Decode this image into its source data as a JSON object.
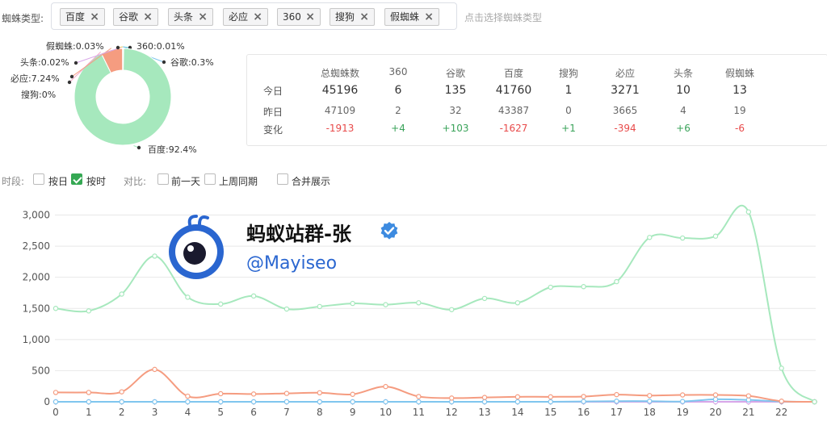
{
  "filter": {
    "label": "蜘蛛类型:",
    "tags": [
      {
        "label": "百度"
      },
      {
        "label": "谷歌"
      },
      {
        "label": "头条"
      },
      {
        "label": "必应"
      },
      {
        "label": "360"
      },
      {
        "label": "搜狗"
      },
      {
        "label": "假蜘蛛"
      }
    ],
    "placeholder": "点击选择蜘蛛类型"
  },
  "pie": {
    "slices": [
      {
        "name": "百度",
        "pct": 92.4,
        "label": "百度:92.4%",
        "color": "#a6e8bd"
      },
      {
        "name": "必应",
        "pct": 7.24,
        "label": "必应:7.24%",
        "color": "#f59c80"
      },
      {
        "name": "谷歌",
        "pct": 0.3,
        "label": "谷歌:0.3%",
        "color": "#7fc6ee"
      },
      {
        "name": "头条",
        "pct": 0.02,
        "label": "头条:0.02%",
        "color": "#d7a6e8"
      },
      {
        "name": "假蜘蛛",
        "pct": 0.03,
        "label": "假蜘蛛:0.03%",
        "color": "#f4d36b"
      },
      {
        "name": "360",
        "pct": 0.01,
        "label": "360:0.01%",
        "color": "#7ad3d3"
      },
      {
        "name": "搜狗",
        "pct": 0,
        "label": "搜狗:0%",
        "color": "#f5a9c8"
      }
    ]
  },
  "stats": {
    "headers": [
      "总蜘蛛数",
      "360",
      "谷歌",
      "百度",
      "搜狗",
      "必应",
      "头条",
      "假蜘蛛"
    ],
    "row_labels": {
      "today": "今日",
      "yesterday": "昨日",
      "change": "变化"
    },
    "today": [
      "45196",
      "6",
      "135",
      "41760",
      "1",
      "3271",
      "10",
      "13"
    ],
    "yesterday": [
      "47109",
      "2",
      "32",
      "43387",
      "0",
      "3665",
      "4",
      "19"
    ],
    "change": [
      "-1913",
      "+4",
      "+103",
      "-1627",
      "+1",
      "-394",
      "+6",
      "-6"
    ]
  },
  "controls": {
    "period_label": "时段:",
    "by_day": "按日",
    "by_hour": "按时",
    "compare_label": "对比:",
    "prev_day": "前一天",
    "last_week": "上周同期",
    "merge": "合并展示",
    "states": {
      "by_day": false,
      "by_hour": true,
      "prev_day": false,
      "last_week": false,
      "merge": false
    }
  },
  "watermark": {
    "name": "蚂蚁站群-张",
    "handle": "@Mayiseo"
  },
  "chart_data": {
    "type": "line",
    "x": [
      0,
      1,
      2,
      3,
      4,
      5,
      6,
      7,
      8,
      9,
      10,
      11,
      12,
      13,
      14,
      15,
      16,
      17,
      18,
      19,
      20,
      21,
      22,
      23
    ],
    "xticks": [
      "0",
      "1",
      "2",
      "3",
      "4",
      "5",
      "6",
      "7",
      "8",
      "9",
      "10",
      "11",
      "12",
      "13",
      "14",
      "15",
      "16",
      "17",
      "18",
      "19",
      "20",
      "21",
      "22"
    ],
    "yticks": [
      "0",
      "500",
      "1,000",
      "1,500",
      "2,000",
      "2,500",
      "3,000"
    ],
    "ylim": [
      0,
      3100
    ],
    "grid": true,
    "series": [
      {
        "color": "#a6e8bd",
        "values": [
          1500,
          1460,
          1730,
          2340,
          1680,
          1570,
          1700,
          1490,
          1530,
          1580,
          1560,
          1590,
          1480,
          1660,
          1590,
          1840,
          1850,
          1930,
          2640,
          2630,
          2660,
          3050,
          540,
          0
        ]
      },
      {
        "color": "#f59c80",
        "values": [
          150,
          150,
          160,
          520,
          90,
          130,
          125,
          135,
          145,
          120,
          245,
          85,
          60,
          70,
          80,
          80,
          85,
          115,
          100,
          110,
          110,
          95,
          10,
          0
        ]
      },
      {
        "color": "#7fc6ee",
        "values": [
          0,
          0,
          0,
          0,
          0,
          0,
          0,
          0,
          0,
          0,
          0,
          0,
          0,
          0,
          0,
          0,
          5,
          10,
          10,
          5,
          40,
          30,
          5,
          0
        ]
      },
      {
        "color": "#d7a6e8",
        "values": [
          0,
          0,
          0,
          0,
          0,
          0,
          0,
          0,
          0,
          0,
          0,
          0,
          0,
          0,
          0,
          0,
          0,
          0,
          0,
          0,
          0,
          0,
          0,
          0
        ]
      }
    ]
  }
}
